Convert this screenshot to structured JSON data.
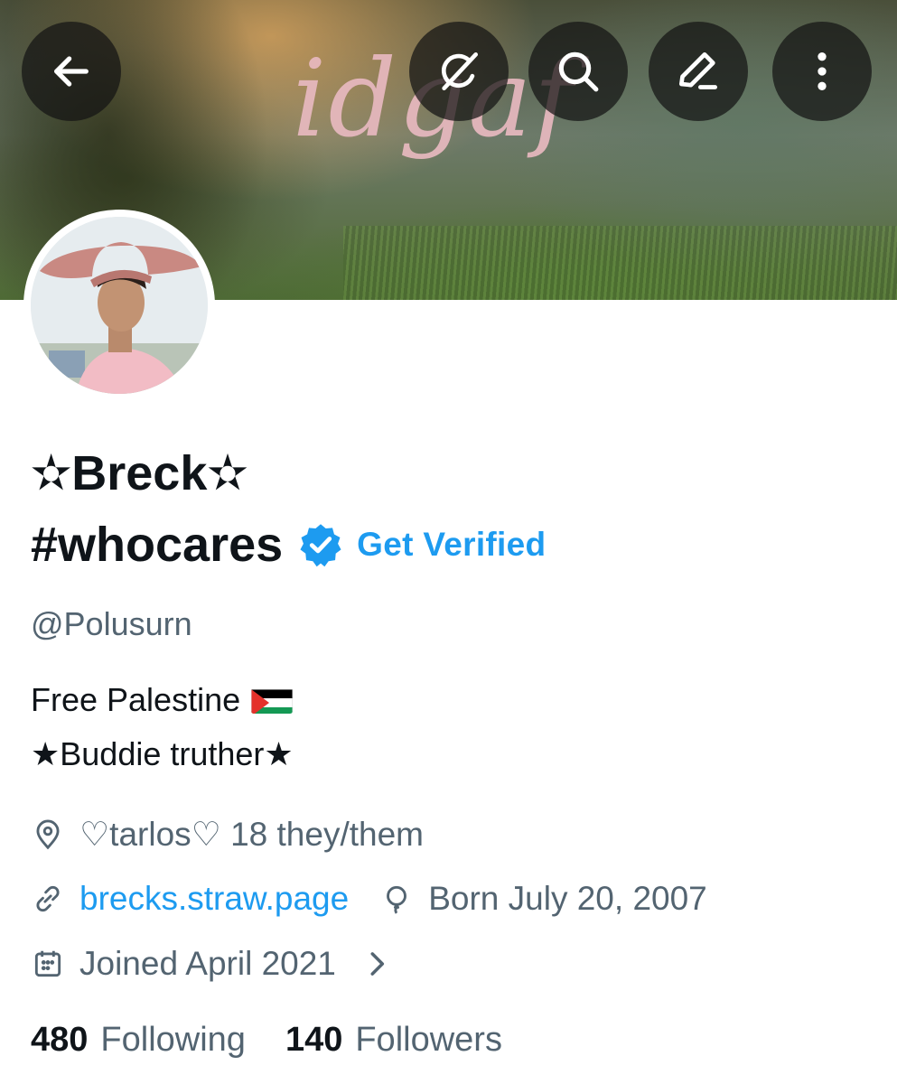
{
  "banner": {
    "text": "idgaf"
  },
  "header_buttons": {
    "back": "back-arrow-icon",
    "grok": "grok-icon",
    "search": "search-icon",
    "edit": "edit-pencil-icon",
    "more": "more-vertical-icon"
  },
  "profile": {
    "name_line1": "✫Breck✫",
    "name_line2": "#whocares",
    "get_verified": "Get Verified",
    "handle": "@Polusurn",
    "bio_line1": "Free Palestine",
    "bio_line2": "★Buddie truther★",
    "location": "♡tarlos♡ 18 they/them",
    "website": "brecks.straw.page",
    "birthday": "Born July 20, 2007",
    "joined": "Joined April 2021"
  },
  "stats": {
    "following_count": "480",
    "following_label": "Following",
    "followers_count": "140",
    "followers_label": "Followers"
  },
  "colors": {
    "accent": "#1d9bf0",
    "secondary_text": "#536471",
    "primary_text": "#0f1419",
    "banner_text": "#e8b9c0"
  }
}
